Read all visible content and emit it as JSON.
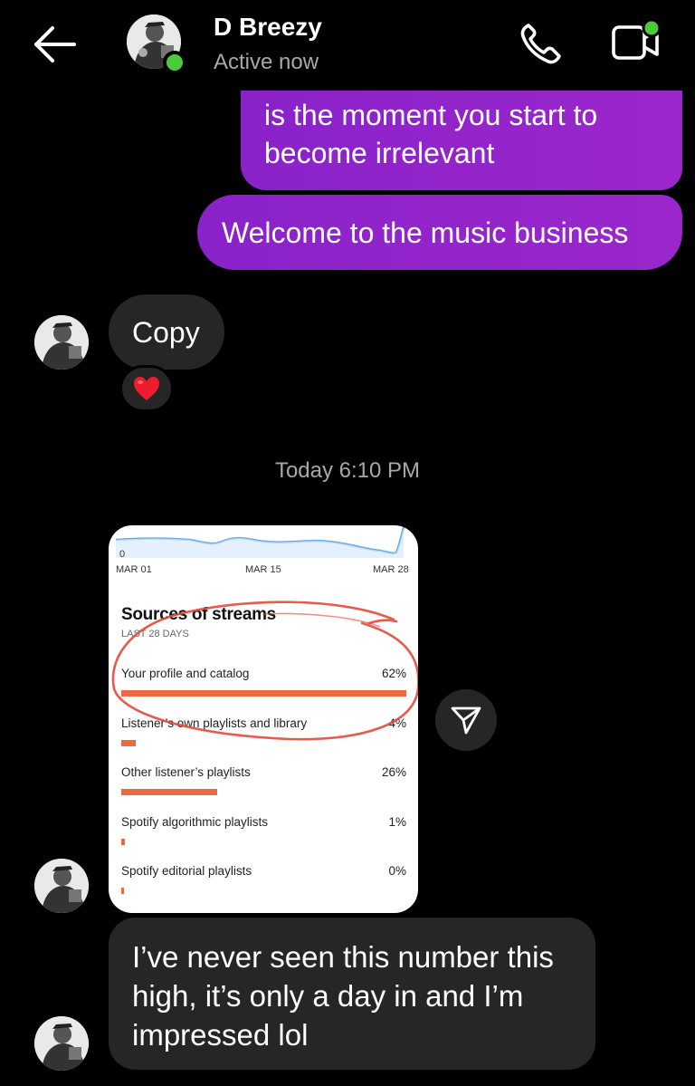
{
  "header": {
    "contact_name": "D Breezy",
    "status": "Active now",
    "back_icon": "arrow-left-icon",
    "call_icon": "phone-icon",
    "video_icon": "video-camera-icon",
    "online_color": "#4ccb3a"
  },
  "messages": {
    "outgoing_1": "is the moment you start to become irrelevant",
    "outgoing_2": "Welcome to the music business",
    "incoming_1": "Copy",
    "reaction": "❤️",
    "timestamp": "Today 6:10 PM",
    "incoming_2": "I’ve never seen this number this high, it’s only a day in and I’m impressed lol"
  },
  "shared_screenshot": {
    "chart_zero": "0",
    "x_labels": [
      "MAR 01",
      "MAR 15",
      "MAR 28"
    ],
    "title": "Sources of streams",
    "subtitle": "LAST 28 DAYS",
    "rows": [
      {
        "label": "Your profile and catalog",
        "percent": "62%",
        "value": 0.62
      },
      {
        "label": "Listener’s own playlists and library",
        "percent": "4%",
        "value": 0.04
      },
      {
        "label": "Other listener’s playlists",
        "percent": "26%",
        "value": 0.26
      },
      {
        "label": "Spotify algorithmic playlists",
        "percent": "1%",
        "value": 0.01
      },
      {
        "label": "Spotify editorial playlists",
        "percent": "0%",
        "value": 0.0
      }
    ]
  },
  "colors": {
    "outgoing_bubble": "#9b27cc",
    "incoming_bubble": "#262626",
    "bar": "#ec6a42",
    "annotation": "#e04a3a"
  }
}
